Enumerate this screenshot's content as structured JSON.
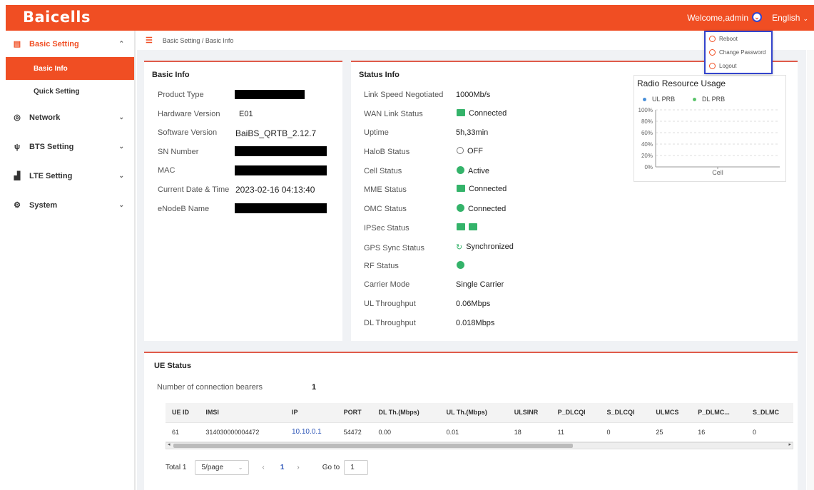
{
  "header": {
    "logo_text": "Baicells",
    "welcome": "Welcome,admin",
    "language": "English",
    "user_menu": [
      "Reboot",
      "Change Password",
      "Logout"
    ]
  },
  "sidebar": {
    "groups": [
      {
        "label": "Basic Setting",
        "icon": "document-icon",
        "expanded": true
      },
      {
        "label": "Network",
        "icon": "globe-icon"
      },
      {
        "label": "BTS Setting",
        "icon": "antenna-icon"
      },
      {
        "label": "LTE Setting",
        "icon": "signal-bars-icon"
      },
      {
        "label": "System",
        "icon": "gear-icon"
      }
    ],
    "sub_items": [
      "Basic Info",
      "Quick Setting"
    ]
  },
  "breadcrumb": "Basic Setting / Basic Info",
  "basic_info": {
    "title": "Basic Info",
    "labels": [
      "Product Type",
      "Hardware Version",
      "Software Version",
      "SN Number",
      "MAC",
      "Current Date & Time",
      "eNodeB Name"
    ],
    "hardware_version": "E01",
    "software_version": "BaiBS_QRTB_2.12.7",
    "current_date_time": "2023-02-16 04:13:40"
  },
  "status_info": {
    "title": "Status Info",
    "rows": [
      {
        "label": "Link Speed Negotiated",
        "value": "1000Mb/s"
      },
      {
        "label": "WAN Link Status",
        "value": "Connected"
      },
      {
        "label": "Uptime",
        "value": "5h,33min"
      },
      {
        "label": "HaloB Status",
        "value": "OFF"
      },
      {
        "label": "Cell Status",
        "value": "Active"
      },
      {
        "label": "MME Status",
        "value": "Connected"
      },
      {
        "label": "OMC Status",
        "value": "Connected"
      },
      {
        "label": "IPSec Status",
        "value": ""
      },
      {
        "label": "GPS Sync Status",
        "value": "Synchronized"
      },
      {
        "label": "RF Status",
        "value": ""
      },
      {
        "label": "Carrier Mode",
        "value": "Single Carrier"
      },
      {
        "label": "UL Throughput",
        "value": "0.06Mbps"
      },
      {
        "label": "DL Throughput",
        "value": "0.018Mbps"
      }
    ]
  },
  "chart_data": {
    "type": "line",
    "title": "Radio Resource Usage",
    "series": [
      {
        "name": "UL PRB",
        "color": "#4a90d9",
        "values": []
      },
      {
        "name": "DL PRB",
        "color": "#5cc46c",
        "values": []
      }
    ],
    "categories": [
      "Cell"
    ],
    "y_ticks": [
      "100%",
      "80%",
      "60%",
      "40%",
      "20%",
      "0%"
    ],
    "ylim": [
      0,
      100
    ],
    "grid": true,
    "legend_position": "top"
  },
  "ue_status": {
    "title": "UE Status",
    "bearers_label": "Number of connection bearers",
    "bearers_value": "1",
    "columns": [
      "UE ID",
      "IMSI",
      "IP",
      "PORT",
      "DL Th.(Mbps)",
      "UL Th.(Mbps)",
      "ULSINR",
      "P_DLCQI",
      "S_DLCQI",
      "ULMCS",
      "P_DLMC...",
      "S_DLMC"
    ],
    "rows": [
      [
        "61",
        "314030000004472",
        "10.10.0.1",
        "54472",
        "0.00",
        "0.01",
        "18",
        "11",
        "0",
        "25",
        "16",
        "0"
      ]
    ],
    "total": "Total 1",
    "page_size": "5/page",
    "current_page": "1",
    "goto_label": "Go to",
    "goto_value": "1"
  },
  "colors": {
    "accent": "#f04e23",
    "status_green": "#34b36a",
    "link": "#2d56b8"
  }
}
